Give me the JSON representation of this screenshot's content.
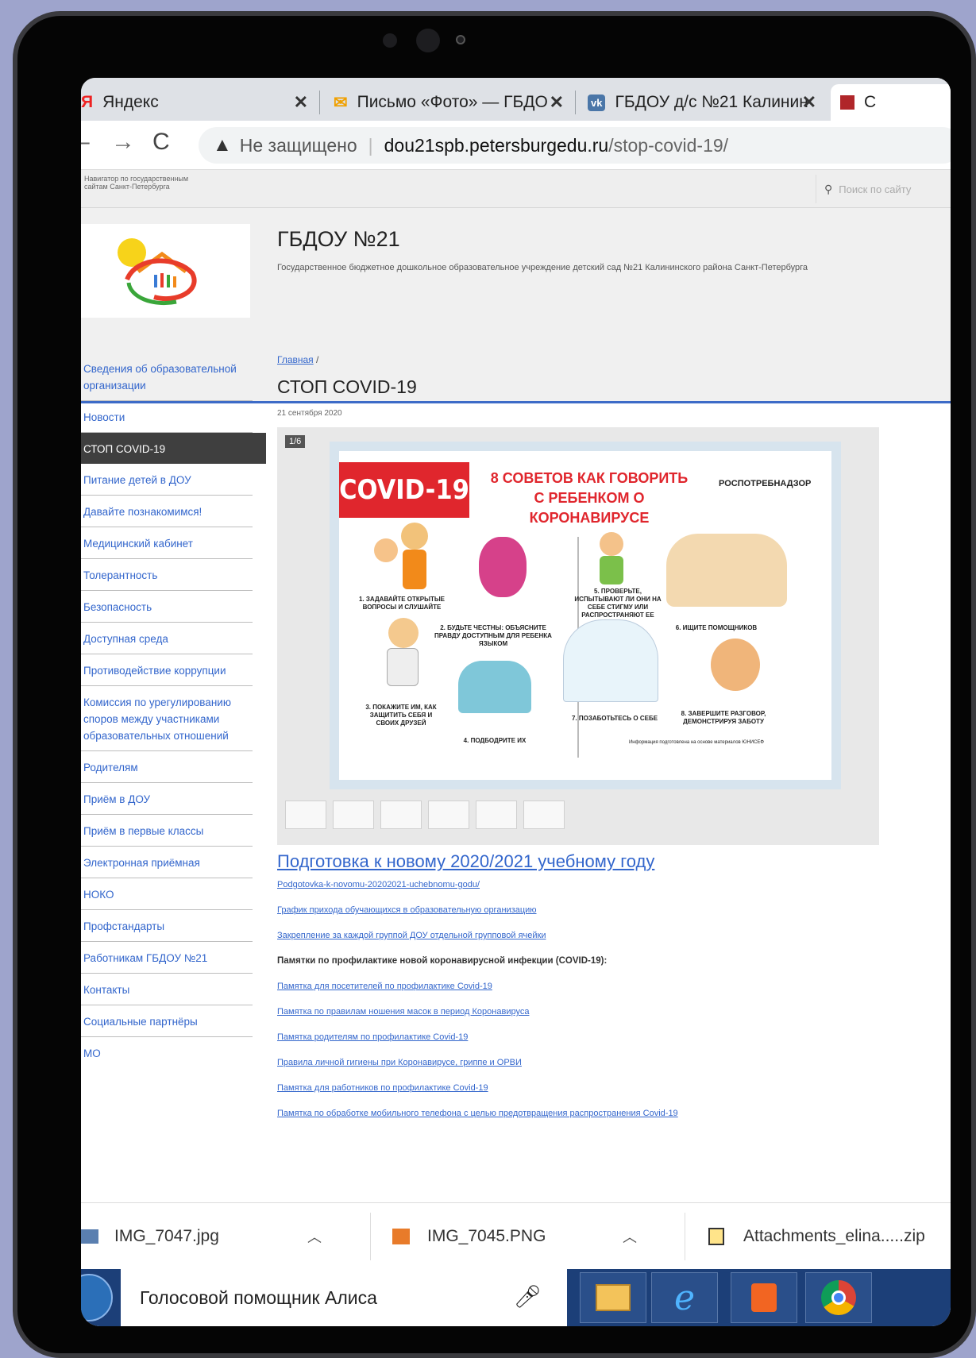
{
  "tabs": [
    {
      "icon": "Я",
      "title": "Яндекс"
    },
    {
      "icon": "✉",
      "title": "Письмо «Фото» — ГБДО"
    },
    {
      "icon": "vk",
      "title": "ГБДОУ д/с №21 Калинин"
    },
    {
      "icon": "",
      "title": "С"
    }
  ],
  "address": {
    "warning": "Не защищено",
    "host": "dou21spb.petersburgedu.ru",
    "path": "/stop-covid-19/"
  },
  "topstrip": {
    "navigator": "Навигатор по государственным сайтам Санкт-Петербурга",
    "search_placeholder": "Поиск по сайту"
  },
  "site": {
    "title": "ГБДОУ №21",
    "subtitle": "Государственное бюджетное дошкольное образовательное учреждение детский сад №21 Калининского района Санкт-Петербурга"
  },
  "sidebar": [
    "Сведения об образовательной организации",
    "Новости",
    "СТОП COVID-19",
    "Питание детей в ДОУ",
    "Давайте познакомимся!",
    "Медицинский кабинет",
    "Толерантность",
    "Безопасность",
    "Доступная среда",
    "Противодействие коррупции",
    "Комиссия по урегулированию споров между участниками образовательных отношений",
    "Родителям",
    "Приём в ДОУ",
    "Приём в первые классы",
    "Электронная приёмная",
    "НОКО",
    "Профстандарты",
    "Работникам ГБДОУ №21",
    "Контакты",
    "Социальные партнёры",
    "МО"
  ],
  "main": {
    "crumb_home": "Главная",
    "crumb_sep": " /",
    "title": "СТОП COVID-19",
    "date": "21 сентября 2020",
    "gallery_counter": "1/6",
    "poster": {
      "badge": "COVID-19",
      "heading": "8 СОВЕТОВ КАК ГОВОРИТЬ С РЕБЕНКОМ О КОРОНАВИРУСЕ",
      "org": "РОСПОТРЕБНАДЗОР",
      "tips": [
        "1. Задавайте открытые вопросы и слушайте",
        "2. Будьте честны: объясните правду доступным для ребенка языком",
        "3. Покажите им, как защитить себя и своих друзей",
        "4. Подбодрите их",
        "5. Проверьте, испытывают ли они на себе стигму или распространяют ее",
        "6. Ищите помощников",
        "7. Позаботьтесь о себе",
        "8. Завершите разговор, демонстрируя заботу"
      ],
      "footnote": "Информация подготовлена на основе материалов ЮНИСЕФ"
    },
    "big_link": "Подготовка к новому 2020/2021 учебному году",
    "links_top": [
      "Podgotovka-k-novomu-20202021-uchebnomu-godu/",
      "График прихода обучающихся в образовательную организацию",
      "Закрепление за каждой группой ДОУ отдельной групповой ячейки"
    ],
    "memo_heading": "Памятки по профилактике новой коронавирусной инфекции (COVID-19):",
    "links_bottom": [
      "Памятка для посетителей по профилактике Covid-19",
      "Памятка по правилам ношения масок в период Коронавируса",
      "Памятка родителям по профилактике Covid-19",
      "Правила личной гигиены при Коронавирусе, гриппе и ОРВИ",
      "Памятка для работников по профилактике Covid-19",
      "Памятка по обработке мобильного телефона с целью предотвращения распространения Covid-19"
    ]
  },
  "downloads": [
    "IMG_7047.jpg",
    "IMG_7045.PNG",
    "Attachments_elina.....zip"
  ],
  "taskbar": {
    "assistant": "Голосовой помощник Алиса"
  }
}
